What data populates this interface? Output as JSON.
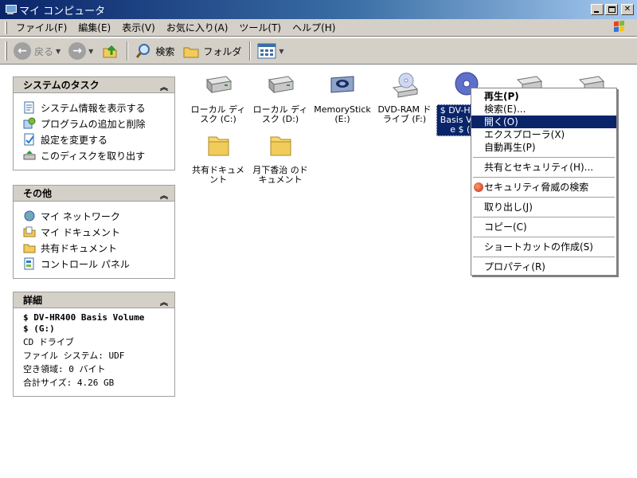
{
  "window": {
    "title": "マイ コンピュータ"
  },
  "menubar": {
    "items": [
      "ファイル(F)",
      "編集(E)",
      "表示(V)",
      "お気に入り(A)",
      "ツール(T)",
      "ヘルプ(H)"
    ]
  },
  "toolbar": {
    "back": "戻る",
    "search": "検索",
    "folders": "フォルダ"
  },
  "sidebar": {
    "system_tasks": {
      "title": "システムのタスク",
      "items": [
        "システム情報を表示する",
        "プログラムの追加と削除",
        "設定を変更する",
        "このディスクを取り出す"
      ]
    },
    "other": {
      "title": "その他",
      "items": [
        "マイ ネットワーク",
        "マイ ドキュメント",
        "共有ドキュメント",
        "コントロール パネル"
      ]
    },
    "details": {
      "title": "詳細",
      "device_name_line1": "$ DV-HR400 Basis Volume",
      "device_name_line2": "$ (G:)",
      "type": "CD ドライブ",
      "filesystem": "ファイル システム: UDF",
      "free_space": "空き領域: 0 バイト",
      "total_size": "合計サイズ: 4.26 GB"
    }
  },
  "drives": [
    {
      "label": "ローカル ディスク (C:)",
      "icon": "hard-disk-icon"
    },
    {
      "label": "ローカル ディスク (D:)",
      "icon": "hard-disk-icon"
    },
    {
      "label": "MemoryStick (E:)",
      "icon": "memory-stick-icon"
    },
    {
      "label": "DVD-RAM ドライブ (F:)",
      "icon": "dvd-drive-icon"
    },
    {
      "label": "$ DV-HR400 Basis Volume $ (G:)",
      "icon": "cd-disc-icon",
      "selected": true
    }
  ],
  "folders": [
    {
      "label": "共有ドキュメント",
      "icon": "folder-icon"
    },
    {
      "label": "月下香治 のドキュメント",
      "icon": "folder-icon"
    }
  ],
  "context_menu": {
    "items": [
      {
        "label": "再生(P)",
        "bold": true
      },
      {
        "label": "検索(E)..."
      },
      {
        "label": "開く(O)",
        "active": true
      },
      {
        "label": "エクスプローラ(X)"
      },
      {
        "label": "自動再生(P)"
      },
      {
        "sep": true
      },
      {
        "label": "共有とセキュリティ(H)..."
      },
      {
        "sep": true
      },
      {
        "label": "セキュリティ脅威の検索",
        "icon": "antivirus-icon"
      },
      {
        "sep": true
      },
      {
        "label": "取り出し(J)"
      },
      {
        "sep": true
      },
      {
        "label": "コピー(C)"
      },
      {
        "sep": true
      },
      {
        "label": "ショートカットの作成(S)"
      },
      {
        "sep": true
      },
      {
        "label": "プロパティ(R)"
      }
    ]
  },
  "colors": {
    "titlebar_start": "#0a246a",
    "titlebar_end": "#a6caf0",
    "selection": "#0a246a",
    "chrome": "#d4d0c8"
  }
}
